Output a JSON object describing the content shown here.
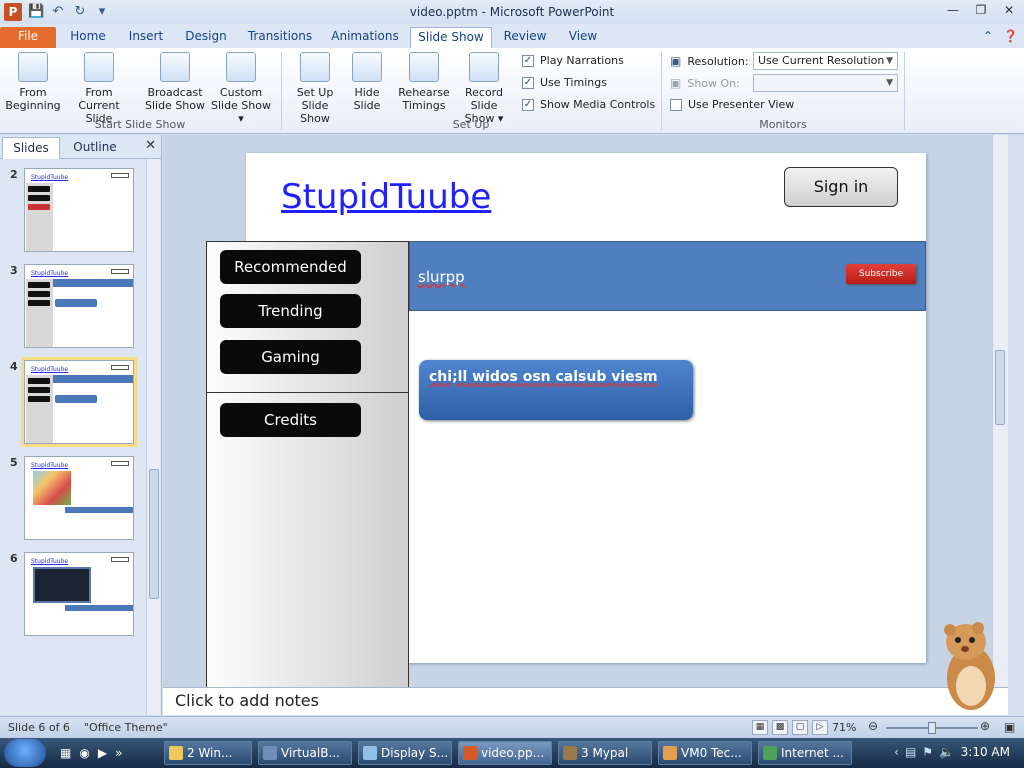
{
  "titlebar": {
    "title": "video.pptm - Microsoft PowerPoint",
    "logo_letter": "P"
  },
  "ribbon_tabs": [
    {
      "label": "File"
    },
    {
      "label": "Home"
    },
    {
      "label": "Insert"
    },
    {
      "label": "Design"
    },
    {
      "label": "Transitions"
    },
    {
      "label": "Animations"
    },
    {
      "label": "Slide Show"
    },
    {
      "label": "Review"
    },
    {
      "label": "View"
    }
  ],
  "ribbon": {
    "start_group": {
      "label": "Start Slide Show",
      "buttons": [
        {
          "line1": "From",
          "line2": "Beginning"
        },
        {
          "line1": "From",
          "line2": "Current Slide"
        },
        {
          "line1": "Broadcast",
          "line2": "Slide Show"
        },
        {
          "line1": "Custom",
          "line2": "Slide Show ▾"
        }
      ]
    },
    "setup_group": {
      "label": "Set Up",
      "buttons": [
        {
          "line1": "Set Up",
          "line2": "Slide Show"
        },
        {
          "line1": "Hide",
          "line2": "Slide"
        },
        {
          "line1": "Rehearse",
          "line2": "Timings"
        },
        {
          "line1": "Record Slide",
          "line2": "Show ▾"
        }
      ],
      "checkboxes": [
        {
          "label": "Play Narrations",
          "checked": true
        },
        {
          "label": "Use Timings",
          "checked": true
        },
        {
          "label": "Show Media Controls",
          "checked": true
        }
      ]
    },
    "monitors_group": {
      "label": "Monitors",
      "resolution_label": "Resolution:",
      "resolution_value": "Use Current Resolution",
      "show_on_label": "Show On:",
      "presenter_view_label": "Use Presenter View"
    }
  },
  "left_pane": {
    "tabs": [
      "Slides",
      "Outline"
    ],
    "slide_numbers": [
      "2",
      "3",
      "4",
      "5",
      "6"
    ],
    "selected_slide": "4"
  },
  "slide": {
    "site_title": "StupidTuube",
    "signin_label": "Sign in",
    "nav_items": [
      "Recommended",
      "Trending",
      "Gaming"
    ],
    "credits_label": "Credits",
    "channel_name": "slurpp",
    "subscribe_label": "Subscribe",
    "video_title": "chi;ll widos osn calsub viesm"
  },
  "notes_placeholder": "Click to add notes",
  "statusbar": {
    "slide_info": "Slide 6 of 6",
    "theme": "\"Office Theme\"",
    "zoom": "71%"
  },
  "taskbar": {
    "items": [
      "2 Win...",
      "VirtualB...",
      "Display S...",
      "video.pp...",
      "3 Mypal",
      "VM0 Tec...",
      "Internet ..."
    ],
    "clock": "3:10 AM"
  },
  "colors": {
    "accent": "#4f7fbe",
    "file_tab": "#e46b2d",
    "subscribe": "#c9261f",
    "title_link": "#2020ff"
  }
}
